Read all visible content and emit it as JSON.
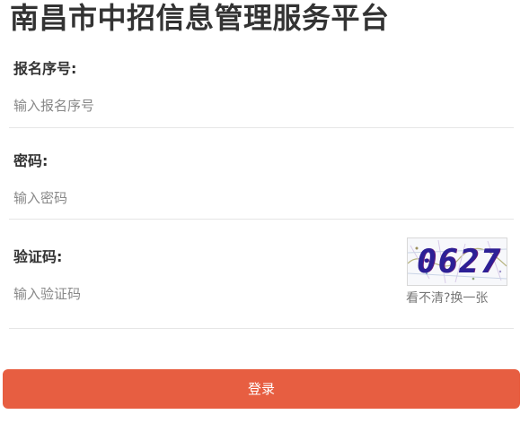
{
  "page": {
    "title": "南昌市中招信息管理服务平台"
  },
  "form": {
    "registration_label": "报名序号:",
    "registration_placeholder": "输入报名序号",
    "registration_value": "",
    "password_label": "密码:",
    "password_placeholder": "输入密码",
    "password_value": "",
    "captcha_label": "验证码:",
    "captcha_placeholder": "输入验证码",
    "captcha_value": "",
    "captcha_image_text": "0627",
    "captcha_refresh_text": "看不清?换一张",
    "login_button_label": "登录"
  },
  "colors": {
    "accent": "#e75e41",
    "text": "#333333",
    "placeholder": "#888888",
    "divider": "#e6e6e6",
    "captcha_ink": "#2c2096"
  }
}
